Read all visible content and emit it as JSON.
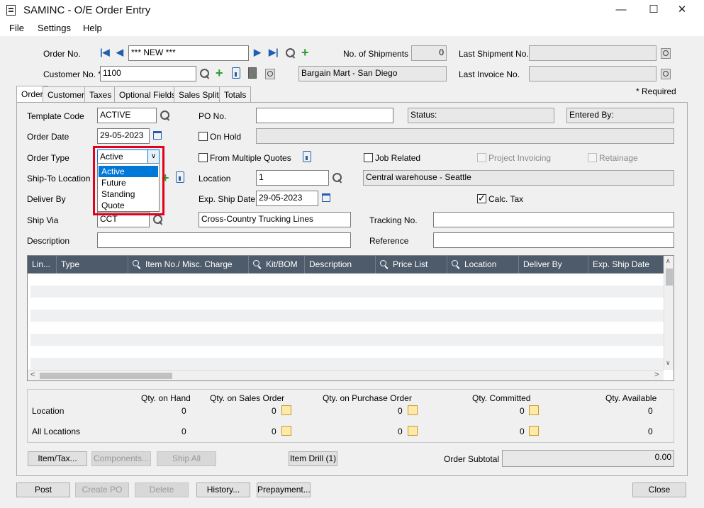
{
  "window": {
    "title": "SAMINC - O/E Order Entry",
    "minimize": "—",
    "maximize": "☐",
    "close": "✕"
  },
  "menu": [
    {
      "label": "File"
    },
    {
      "label": "Settings"
    },
    {
      "label": "Help"
    }
  ],
  "header": {
    "order_no_label": "Order No.",
    "order_no_value": "*** NEW ***",
    "customer_no_label": "Customer No. *",
    "customer_no_value": "1100",
    "customer_name": "Bargain Mart - San Diego",
    "shipments_label": "No. of Shipments",
    "shipments_value": "0",
    "last_shipment_label": "Last Shipment No.",
    "last_shipment_value": "",
    "last_invoice_label": "Last Invoice No.",
    "last_invoice_value": "",
    "required_note": "*  Required"
  },
  "tabs": [
    {
      "label": "Order"
    },
    {
      "label": "Customer"
    },
    {
      "label": "Taxes"
    },
    {
      "label": "Optional Fields"
    },
    {
      "label": "Sales Split"
    },
    {
      "label": "Totals"
    }
  ],
  "order": {
    "template_code_label": "Template Code",
    "template_code_value": "ACTIVE",
    "order_date_label": "Order Date",
    "order_date_value": "29-05-2023",
    "order_type_label": "Order Type",
    "order_type_value": "Active",
    "order_type_options": [
      "Active",
      "Future",
      "Standing",
      "Quote"
    ],
    "ship_to_label": "Ship-To Location",
    "deliver_by_label": "Deliver By",
    "ship_via_label": "Ship Via",
    "ship_via_value": "CCT",
    "description_label": "Description",
    "description_value": "",
    "po_no_label": "PO No.",
    "po_no_value": "",
    "status_label": "Status:",
    "entered_by_label": "Entered By:",
    "on_hold_label": "On Hold",
    "multiple_quotes_label": "From Multiple Quotes",
    "job_related_label": "Job Related",
    "project_invoicing_label": "Project Invoicing",
    "retainage_label": "Retainage",
    "location_label": "Location",
    "location_value": "1",
    "location_name": "Central warehouse - Seattle",
    "exp_ship_date_label": "Exp. Ship Date",
    "exp_ship_date_value": "29-05-2023",
    "calc_tax_label": "Calc. Tax",
    "ship_via_name": "Cross-Country Trucking Lines",
    "tracking_no_label": "Tracking No.",
    "tracking_no_value": "",
    "reference_label": "Reference",
    "reference_value": ""
  },
  "grid": {
    "columns": [
      {
        "label": "Lin..."
      },
      {
        "label": "Type"
      },
      {
        "label": "Item No./ Misc. Charge"
      },
      {
        "label": "Kit/BOM"
      },
      {
        "label": "Description"
      },
      {
        "label": "Price List"
      },
      {
        "label": "Location"
      },
      {
        "label": "Deliver By"
      },
      {
        "label": "Exp. Ship Date"
      }
    ]
  },
  "stock": {
    "headers": [
      "Qty. on Hand",
      "Qty. on Sales Order",
      "Qty. on Purchase Order",
      "Qty. Committed",
      "Qty. Available"
    ],
    "location_label": "Location",
    "all_locations_label": "All Locations",
    "location_values": [
      "0",
      "0",
      "0",
      "0",
      "0"
    ],
    "all_values": [
      "0",
      "0",
      "0",
      "0",
      "0"
    ]
  },
  "actions": {
    "item_tax": "Item/Tax...",
    "components": "Components...",
    "ship_all": "Ship All",
    "item_drill": "Item Drill (1)",
    "order_subtotal_label": "Order Subtotal",
    "order_subtotal_value": "0.00"
  },
  "footer": {
    "post": "Post",
    "create_po": "Create PO",
    "delete": "Delete",
    "history": "History...",
    "prepayment": "Prepayment...",
    "close": "Close"
  }
}
